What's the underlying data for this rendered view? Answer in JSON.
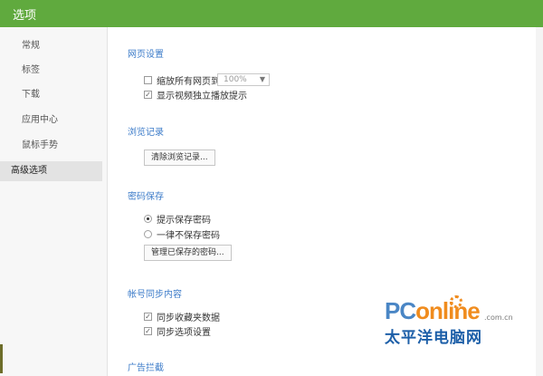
{
  "window": {
    "title": "选项"
  },
  "sidebar": {
    "items": [
      {
        "label": "常规",
        "active": false
      },
      {
        "label": "标签",
        "active": false
      },
      {
        "label": "下载",
        "active": false
      },
      {
        "label": "应用中心",
        "active": false
      },
      {
        "label": "鼠标手势",
        "active": false
      },
      {
        "label": "高级选项",
        "active": true
      }
    ]
  },
  "sections": {
    "web": {
      "title": "网页设置",
      "zoom_label": "缩放所有网页到",
      "zoom_checked": false,
      "zoom_value": "100%",
      "video_label": "显示视频独立播放提示",
      "video_checked": true
    },
    "history": {
      "title": "浏览记录",
      "clear_button": "清除浏览记录..."
    },
    "password": {
      "title": "密码保存",
      "options": [
        {
          "label": "提示保存密码",
          "selected": true
        },
        {
          "label": "一律不保存密码",
          "selected": false
        }
      ],
      "manage_button": "管理已保存的密码..."
    },
    "sync": {
      "title": "帐号同步内容",
      "items": [
        {
          "label": "同步收藏夹数据",
          "checked": true
        },
        {
          "label": "同步选项设置",
          "checked": true
        }
      ]
    },
    "ads": {
      "title": "广告拦截"
    }
  },
  "watermark": {
    "brand_main": "PC",
    "brand_accent": "online",
    "domain": ".com.cn",
    "chinese": "太平洋电脑网"
  },
  "colors": {
    "titlebar": "#60aa3e",
    "section_title": "#3d7cc9"
  }
}
